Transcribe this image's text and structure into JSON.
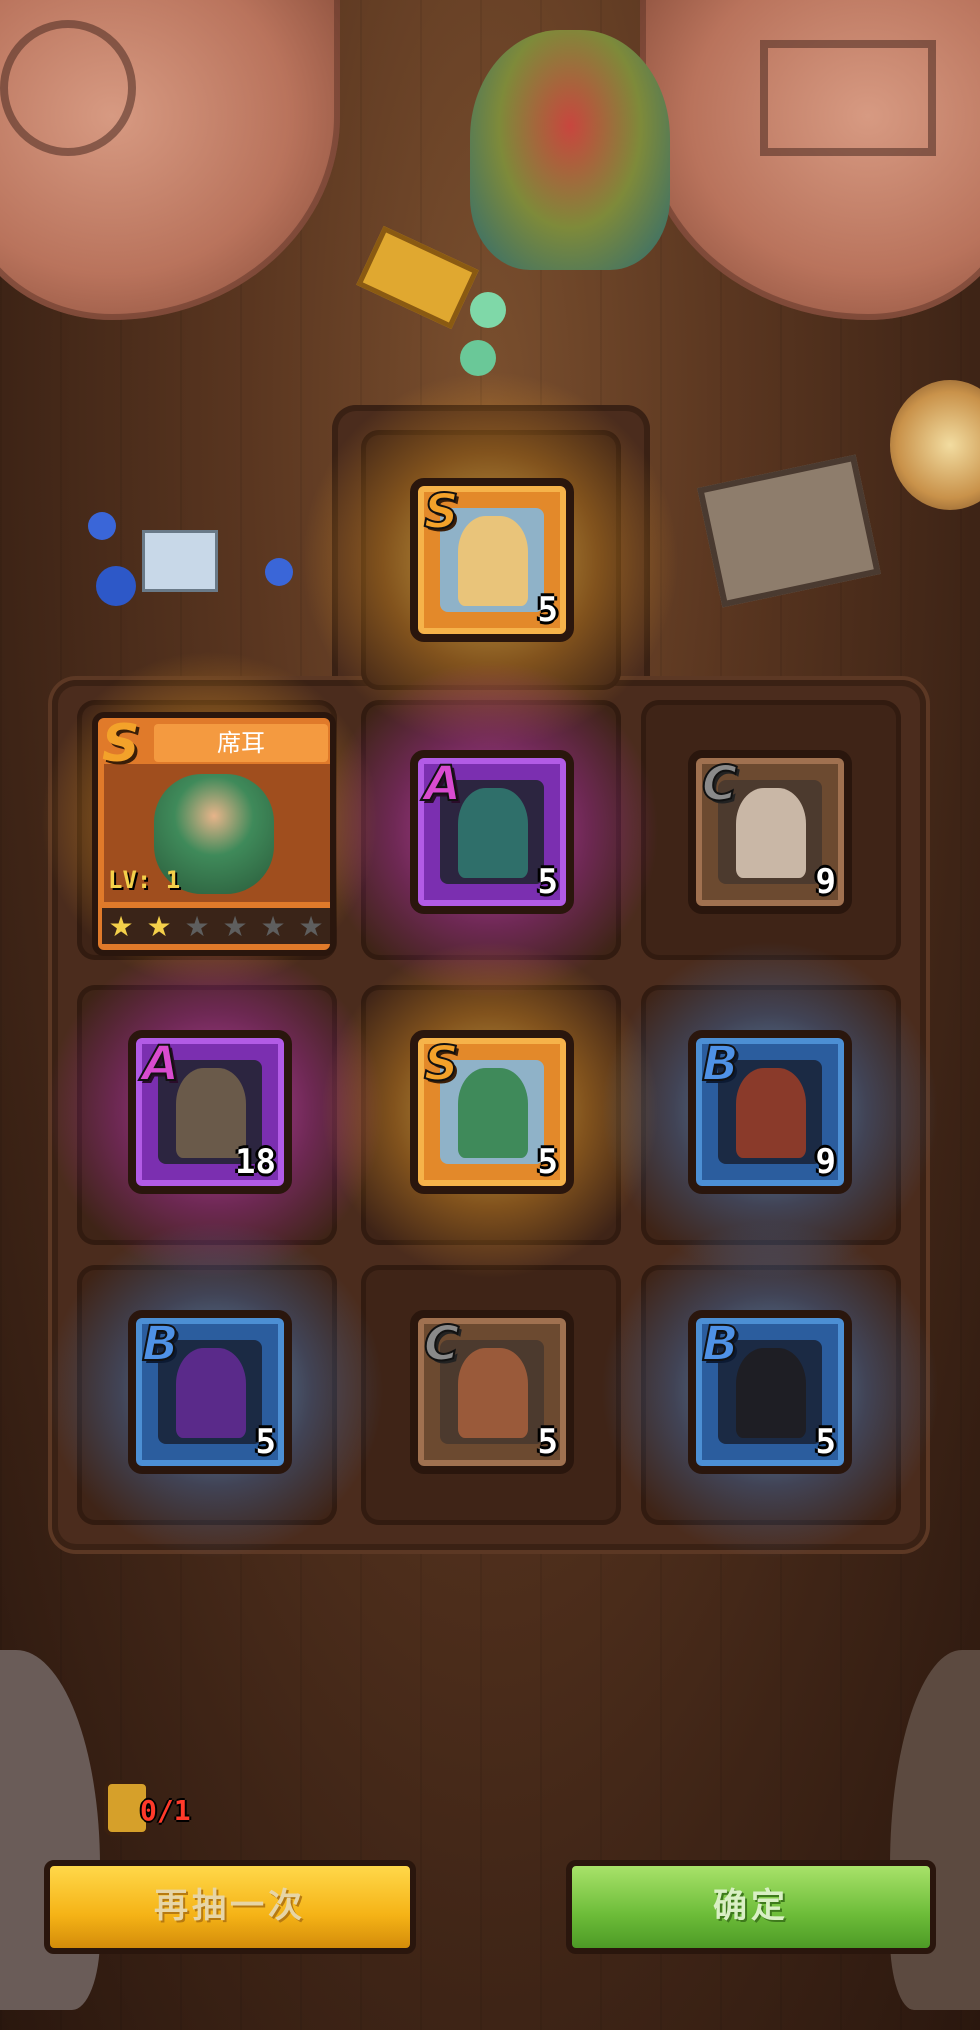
{
  "detail_card": {
    "rank": "S",
    "name": "席耳",
    "level": "LV: 1",
    "stars_filled": 2,
    "stars_total": 6
  },
  "heroes": [
    {
      "id": "top",
      "rank": "S",
      "count": "5",
      "color": "#e3892a"
    },
    {
      "id": "row1-mid",
      "rank": "A",
      "count": "5",
      "color": "#7b2fb0"
    },
    {
      "id": "row1-right",
      "rank": "C",
      "count": "9",
      "color": "#6c4a30"
    },
    {
      "id": "row2-left",
      "rank": "A",
      "count": "18",
      "color": "#7b2fb0"
    },
    {
      "id": "row2-mid",
      "rank": "S",
      "count": "5",
      "color": "#e3892a"
    },
    {
      "id": "row2-right",
      "rank": "B",
      "count": "9",
      "color": "#2b5d9e"
    },
    {
      "id": "row3-left",
      "rank": "B",
      "count": "5",
      "color": "#2b5d9e"
    },
    {
      "id": "row3-mid",
      "rank": "C",
      "count": "5",
      "color": "#6c4a30"
    },
    {
      "id": "row3-right",
      "rank": "B",
      "count": "5",
      "color": "#2b5d9e"
    }
  ],
  "ticket": {
    "count": "0/1",
    "icon": "ticket-icon"
  },
  "buttons": {
    "retry": "再抽一次",
    "confirm": "确定"
  },
  "colors": {
    "rank_S": "#f3a22a",
    "rank_A": "#d94bd0",
    "rank_B": "#4f92e6",
    "rank_C": "#8a8a8a",
    "button_retry": "#f5b316",
    "button_confirm": "#6cbc38"
  }
}
